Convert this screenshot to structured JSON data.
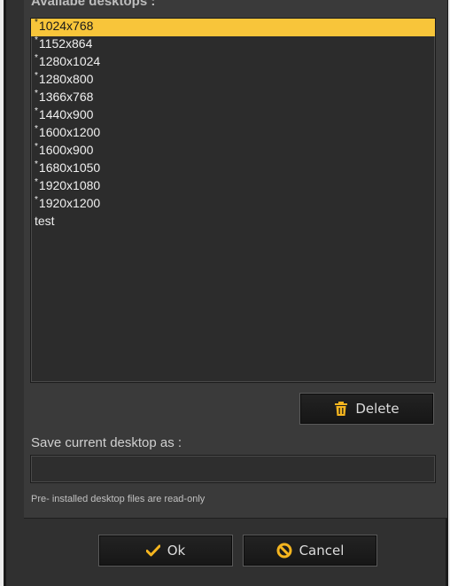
{
  "dialog": {
    "section_title": "Availabe desktops :",
    "desktops": [
      {
        "marker": "*",
        "name": "1024x768",
        "selected": true
      },
      {
        "marker": "*",
        "name": "1152x864",
        "selected": false
      },
      {
        "marker": "*",
        "name": "1280x1024",
        "selected": false
      },
      {
        "marker": "*",
        "name": "1280x800",
        "selected": false
      },
      {
        "marker": "*",
        "name": "1366x768",
        "selected": false
      },
      {
        "marker": "*",
        "name": "1440x900",
        "selected": false
      },
      {
        "marker": "*",
        "name": "1600x1200",
        "selected": false
      },
      {
        "marker": "*",
        "name": "1600x900",
        "selected": false
      },
      {
        "marker": "*",
        "name": "1680x1050",
        "selected": false
      },
      {
        "marker": "*",
        "name": "1920x1080",
        "selected": false
      },
      {
        "marker": "*",
        "name": "1920x1200",
        "selected": false
      },
      {
        "marker": "",
        "name": "test",
        "selected": false
      }
    ],
    "delete_label": "Delete",
    "save_label": "Save current desktop as :",
    "save_value": "",
    "note": "Pre- installed desktop files are read-only",
    "ok_label": "Ok",
    "cancel_label": "Cancel"
  },
  "icons": {
    "delete": "trash-icon",
    "ok": "checkmark-icon",
    "cancel": "cancel-icon"
  },
  "colors": {
    "selection": "#f8c53a",
    "icon_accent": "#f5b51f",
    "background": "#303030"
  }
}
